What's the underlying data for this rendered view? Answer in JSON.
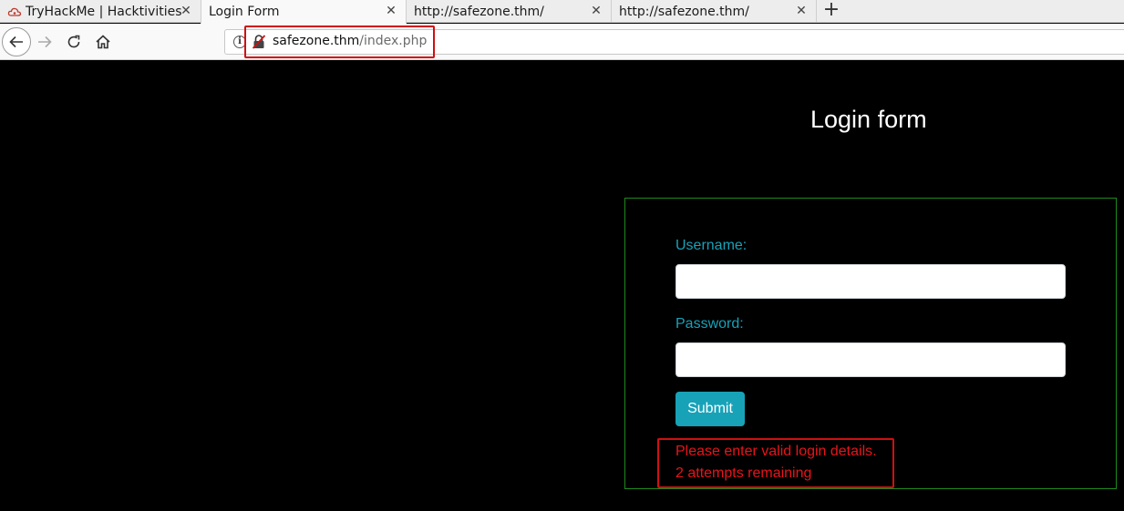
{
  "browser": {
    "tabs": [
      {
        "label": "TryHackMe | Hacktivities",
        "favicon": "cloud-icon",
        "active": false
      },
      {
        "label": "Login Form",
        "favicon": "none",
        "active": true
      },
      {
        "label": "http://safezone.thm/",
        "favicon": "none",
        "active": false
      },
      {
        "label": "http://safezone.thm/",
        "favicon": "none",
        "active": false
      }
    ],
    "close_glyph": "✕",
    "new_tab_glyph": "+",
    "url": {
      "host": "safezone.thm",
      "path": "/index.php"
    },
    "info_glyph": "i"
  },
  "page": {
    "title": "Login form",
    "form": {
      "username_label": "Username:",
      "username_value": "",
      "password_label": "Password:",
      "password_value": "",
      "submit_label": "Submit"
    },
    "error": {
      "line1": "Please enter valid login details.",
      "line2": "2 attempts remaining"
    }
  },
  "colors": {
    "accent": "#17a2b8",
    "error": "#e8141a",
    "highlight_box": "#d01010",
    "panel_border": "#1e8a1e",
    "background": "#000000"
  }
}
